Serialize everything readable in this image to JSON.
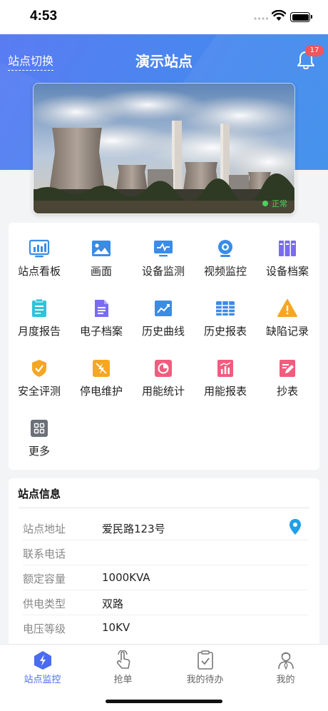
{
  "status_bar": {
    "time": "4:53"
  },
  "header": {
    "switch_label": "站点切换",
    "title": "演示站点",
    "notification_count": "17"
  },
  "banner": {
    "status": "正常"
  },
  "menu": [
    {
      "label": "站点看板",
      "icon": "dashboard-icon"
    },
    {
      "label": "画面",
      "icon": "image-icon"
    },
    {
      "label": "设备监测",
      "icon": "monitor-icon"
    },
    {
      "label": "视频监控",
      "icon": "camera-icon"
    },
    {
      "label": "设备档案",
      "icon": "archive-icon"
    },
    {
      "label": "月度报告",
      "icon": "clipboard-icon"
    },
    {
      "label": "电子档案",
      "icon": "document-icon"
    },
    {
      "label": "历史曲线",
      "icon": "line-chart-icon"
    },
    {
      "label": "历史报表",
      "icon": "table-icon"
    },
    {
      "label": "缺陷记录",
      "icon": "warning-icon"
    },
    {
      "label": "安全评测",
      "icon": "shield-icon"
    },
    {
      "label": "停电维护",
      "icon": "power-off-icon"
    },
    {
      "label": "用能统计",
      "icon": "pie-chart-icon"
    },
    {
      "label": "用能报表",
      "icon": "report-icon"
    },
    {
      "label": "抄表",
      "icon": "edit-icon"
    },
    {
      "label": "更多",
      "icon": "more-grid-icon"
    }
  ],
  "station_info": {
    "title": "站点信息",
    "rows": [
      {
        "key": "站点地址",
        "value": "爱民路123号"
      },
      {
        "key": "联系电话",
        "value": ""
      },
      {
        "key": "额定容量",
        "value": "1000KVA"
      },
      {
        "key": "供电类型",
        "value": "双路"
      },
      {
        "key": "电压等级",
        "value": "10KV"
      }
    ]
  },
  "tabbar": [
    {
      "label": "站点监控",
      "icon": "station-monitor-icon",
      "active": true
    },
    {
      "label": "抢单",
      "icon": "hand-tap-icon",
      "active": false
    },
    {
      "label": "我的待办",
      "icon": "todo-icon",
      "active": false
    },
    {
      "label": "我的",
      "icon": "user-icon",
      "active": false
    }
  ],
  "colors": {
    "primary": "#4a6cf0",
    "header_gradient_start": "#5a7cf2",
    "header_gradient_end": "#3c8eea",
    "badge": "#f0565a",
    "status_ok": "#4cd160"
  }
}
